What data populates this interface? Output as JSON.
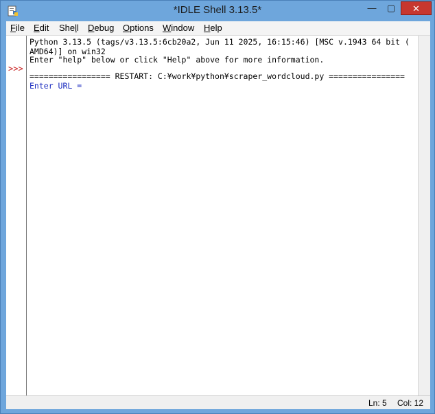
{
  "window": {
    "title": "*IDLE Shell 3.13.5*",
    "controls": {
      "minimize": "—",
      "maximize": "▢",
      "close": "✕"
    }
  },
  "menu": [
    {
      "accel": "F",
      "rest": "ile"
    },
    {
      "accel": "E",
      "rest": "dit"
    },
    {
      "pre": "She",
      "accel": "l",
      "rest": "l"
    },
    {
      "accel": "D",
      "rest": "ebug"
    },
    {
      "accel": "O",
      "rest": "ptions"
    },
    {
      "accel": "W",
      "rest": "indow"
    },
    {
      "accel": "H",
      "rest": "elp"
    }
  ],
  "shell": {
    "prompt": ">>>",
    "lines": [
      "Python 3.13.5 (tags/v3.13.5:6cb20a2, Jun 11 2025, 16:15:46) [MSC v.1943 64 bit (",
      "AMD64)] on win32",
      "Enter \"help\" below or click \"Help\" above for more information.",
      "",
      "================= RESTART: C:¥work¥python¥scraper_wordcloud.py ================",
      "Enter URL = "
    ]
  },
  "status": {
    "ln": "Ln: 5",
    "col": "Col: 12"
  },
  "colors": {
    "frame": "#6ea6dc",
    "prompt": "#c71b1b",
    "stdout_input_prompt": "#1a2bbf"
  }
}
